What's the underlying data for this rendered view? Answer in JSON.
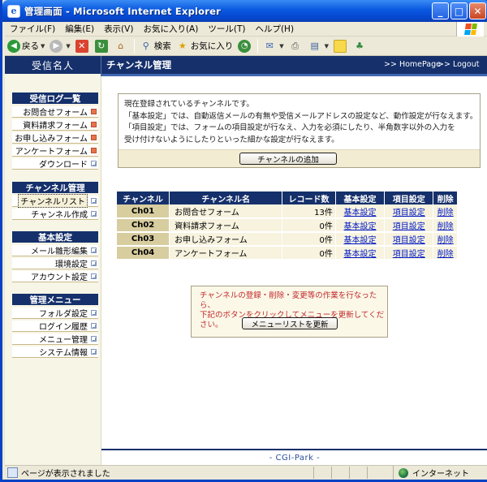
{
  "window": {
    "title": "管理画面 - Microsoft Internet Explorer",
    "app_icon": "ie-icon",
    "buttons": [
      "minimize",
      "maximize",
      "close"
    ]
  },
  "menubar": {
    "items": [
      "ファイル(F)",
      "編集(E)",
      "表示(V)",
      "お気に入り(A)",
      "ツール(T)",
      "ヘルプ(H)"
    ]
  },
  "toolbar": {
    "back": "戻る",
    "search": "検索",
    "favorites": "お気に入り"
  },
  "header": {
    "site_name": "受信名人",
    "page_title": "チャンネル管理",
    "homepage_link": ">> HomePage",
    "logout_link": ">> Logout"
  },
  "sidebar": {
    "sections": [
      {
        "title": "受信ログ一覧",
        "items": [
          {
            "label": "お問合せフォーム",
            "marker": "red"
          },
          {
            "label": "資料請求フォーム",
            "marker": "red"
          },
          {
            "label": "お申し込みフォーム",
            "marker": "red"
          },
          {
            "label": "アンケートフォーム",
            "marker": "red"
          },
          {
            "label": "ダウンロード",
            "marker": "box"
          }
        ]
      },
      {
        "title": "チャンネル管理",
        "items": [
          {
            "label": "チャンネルリスト",
            "marker": "box",
            "active": true
          },
          {
            "label": "チャンネル作成",
            "marker": "box"
          }
        ]
      },
      {
        "title": "基本設定",
        "items": [
          {
            "label": "メール雛形編集",
            "marker": "box"
          },
          {
            "label": "環境設定",
            "marker": "box"
          },
          {
            "label": "アカウント設定",
            "marker": "box"
          }
        ]
      },
      {
        "title": "管理メニュー",
        "items": [
          {
            "label": "フォルダ設定",
            "marker": "box"
          },
          {
            "label": "ログイン履歴",
            "marker": "box"
          },
          {
            "label": "メニュー管理",
            "marker": "box"
          },
          {
            "label": "システム情報",
            "marker": "box"
          }
        ]
      }
    ]
  },
  "info": {
    "lines": [
      "現在登録されているチャンネルです。",
      "「基本設定」では、自動返信メールの有無や受信メールアドレスの設定など、動作設定が行なえます。",
      "「項目設定」では、フォームの項目設定が行なえ、入力を必須にしたり、半角数字以外の入力を",
      "受け付けないようにしたりといった細かな設定が行なえます。"
    ],
    "add_button": "チャンネルの追加"
  },
  "table": {
    "headers": [
      "チャンネル",
      "チャンネル名",
      "レコード数",
      "基本設定",
      "項目設定",
      "削除"
    ],
    "rows": [
      {
        "id": "Ch01",
        "name": "お問合せフォーム",
        "records": "13件",
        "basic": "基本設定",
        "items": "項目設定",
        "delete": "削除"
      },
      {
        "id": "Ch02",
        "name": "資料請求フォーム",
        "records": "0件",
        "basic": "基本設定",
        "items": "項目設定",
        "delete": "削除"
      },
      {
        "id": "Ch03",
        "name": "お申し込みフォーム",
        "records": "0件",
        "basic": "基本設定",
        "items": "項目設定",
        "delete": "削除"
      },
      {
        "id": "Ch04",
        "name": "アンケートフォーム",
        "records": "0件",
        "basic": "基本設定",
        "items": "項目設定",
        "delete": "削除"
      }
    ]
  },
  "notice": {
    "lines": [
      "チャンネルの登録・削除・変更等の作業を行なったら、",
      "下記のボタンをクリックしてメニューを更新してください。"
    ],
    "button": "メニューリストを更新"
  },
  "footer": {
    "text": "- CGI-Park -"
  },
  "status": {
    "text": "ページが表示されました",
    "zone": "インターネット"
  },
  "colors": {
    "navy": "#15306b",
    "beige": "#f7f3df",
    "tan": "#d8cd9f",
    "notice_red": "#c0282a",
    "link": "#0018c4"
  }
}
